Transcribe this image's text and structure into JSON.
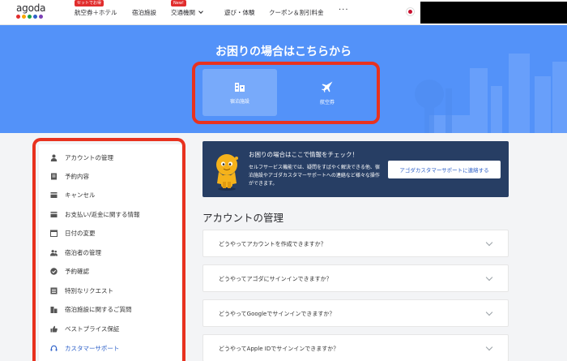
{
  "nav": {
    "logo_text": "agoda",
    "logo_colors": [
      "#e12d2d",
      "#f7a600",
      "#1aa34a",
      "#2f62c9",
      "#7b3fb5"
    ],
    "items": [
      {
        "label": "航空券＋ホテル",
        "badge": "セットでお得"
      },
      {
        "label": "宿泊施設",
        "badge": ""
      },
      {
        "label": "交通機関",
        "badge": "New!"
      },
      {
        "label": "遊び・体験",
        "badge": ""
      },
      {
        "label": "クーポン＆割引料金",
        "badge": ""
      }
    ],
    "more": "···"
  },
  "hero": {
    "title": "お困りの場合はこちらから",
    "categories": [
      {
        "label": "宿泊施設",
        "icon": "building-icon",
        "active": true
      },
      {
        "label": "航空券",
        "icon": "airplane-icon",
        "active": false
      }
    ],
    "bg_color": "#5392f9"
  },
  "sidebar": {
    "items": [
      {
        "label": "アカウントの管理",
        "icon": "person-icon"
      },
      {
        "label": "予約内容",
        "icon": "document-icon"
      },
      {
        "label": "キャンセル",
        "icon": "card-icon"
      },
      {
        "label": "お支払い/返金に関する情報",
        "icon": "card-icon"
      },
      {
        "label": "日付の変更",
        "icon": "calendar-icon"
      },
      {
        "label": "宿泊者の管理",
        "icon": "people-icon"
      },
      {
        "label": "予約確認",
        "icon": "check-circle-icon"
      },
      {
        "label": "特別なリクエスト",
        "icon": "list-icon"
      },
      {
        "label": "宿泊施設に関するご質問",
        "icon": "building-icon"
      },
      {
        "label": "ベストプライス保証",
        "icon": "thumbs-up-icon"
      },
      {
        "label": "カスタマーサポート",
        "icon": "headset-icon",
        "active": true
      }
    ]
  },
  "banner": {
    "title": "お困りの場合はここで情報をチェック！",
    "text": "セルフサービス機能では、疑問をすばやく解決できる他、宿泊施設やアゴダカスタマーサポートへの連絡など様々な操作ができます。",
    "button": "アゴダカスタマーサポートに連絡する"
  },
  "main": {
    "section_title": "アカウントの管理",
    "faqs": [
      "どうやってアカウントを作成できますか？",
      "どうやってアゴダにサインインできますか？",
      "どうやってGoogleでサインインできますか？",
      "どうやってApple IDでサインインできますか？"
    ]
  },
  "colors": {
    "accent": "#2f62c9",
    "highlight": "#e8321f",
    "banner": "#273e64"
  }
}
